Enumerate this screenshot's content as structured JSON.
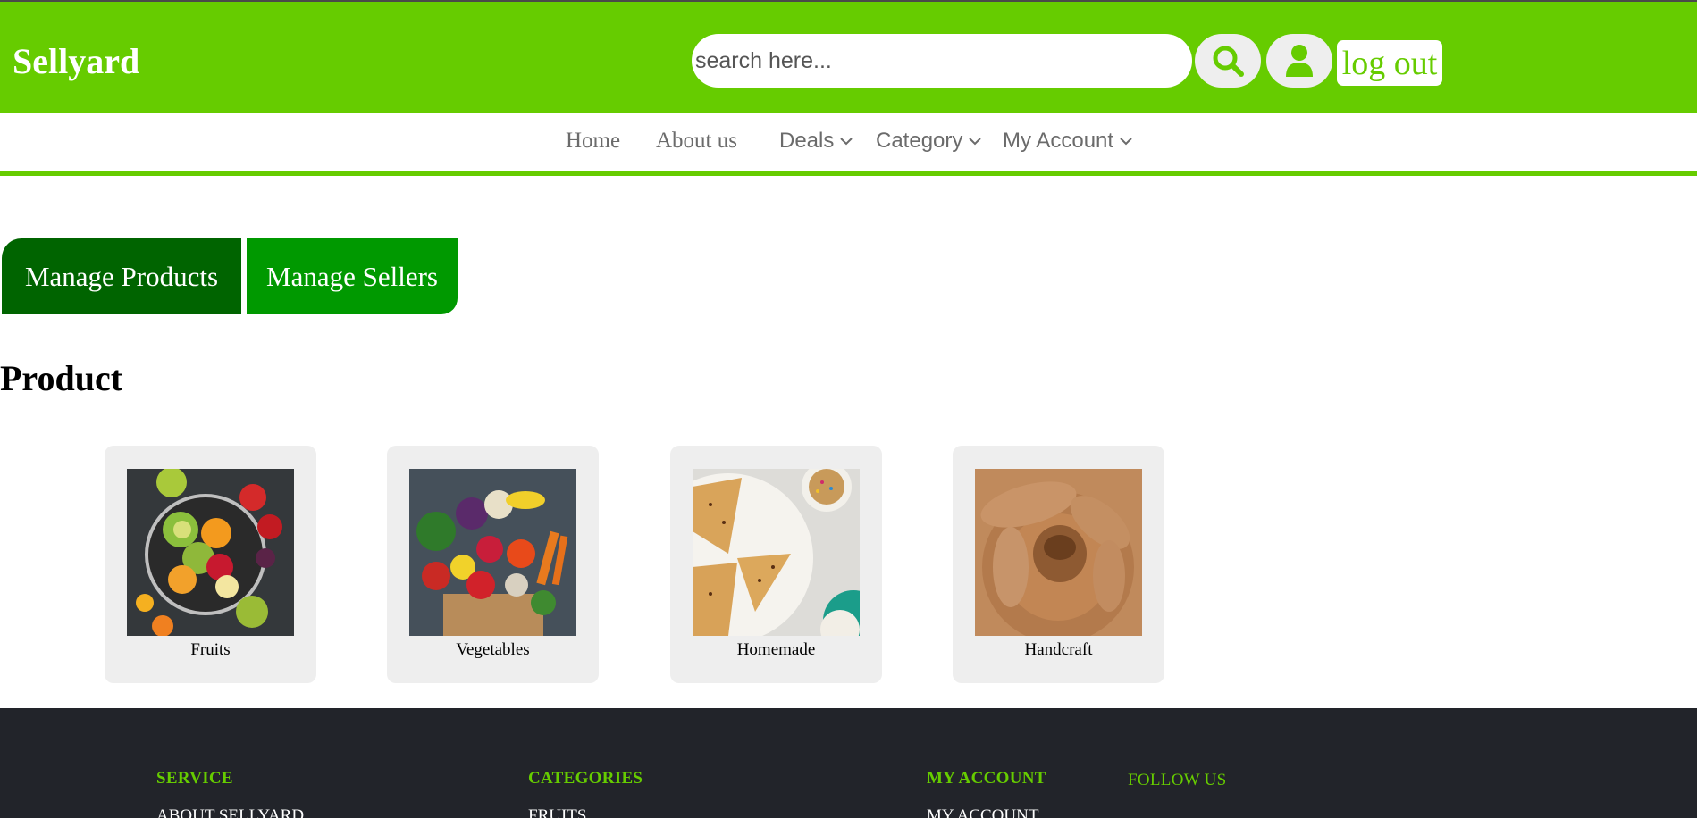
{
  "header": {
    "brand": "Sellyard",
    "search": {
      "placeholder": "search here...",
      "value": ""
    },
    "logout_label": "log out",
    "colors": {
      "bar": "#66cc00",
      "button_bg": "#eeeeee"
    }
  },
  "nav": {
    "items": [
      {
        "label": "Home",
        "has_dropdown": false
      },
      {
        "label": "About us",
        "has_dropdown": false
      },
      {
        "label": "Deals",
        "has_dropdown": true
      },
      {
        "label": "Category",
        "has_dropdown": true
      },
      {
        "label": "My Account",
        "has_dropdown": true
      }
    ]
  },
  "admin_tabs": {
    "manage_products": "Manage Products",
    "manage_sellers": "Manage Sellers"
  },
  "main": {
    "section_title": "Product",
    "categories": [
      {
        "label": "Fruits"
      },
      {
        "label": "Vegetables"
      },
      {
        "label": "Homemade"
      },
      {
        "label": "Handcraft"
      }
    ]
  },
  "footer": {
    "columns": [
      {
        "heading": "SERVICE",
        "first_link": "ABOUT SELLYARD"
      },
      {
        "heading": "CATEGORIES",
        "first_link": "FRUITS"
      },
      {
        "heading": "MY ACCOUNT",
        "first_link": "MY ACCOUNT"
      },
      {
        "heading": "FOLLOW US",
        "first_link": ""
      }
    ]
  }
}
